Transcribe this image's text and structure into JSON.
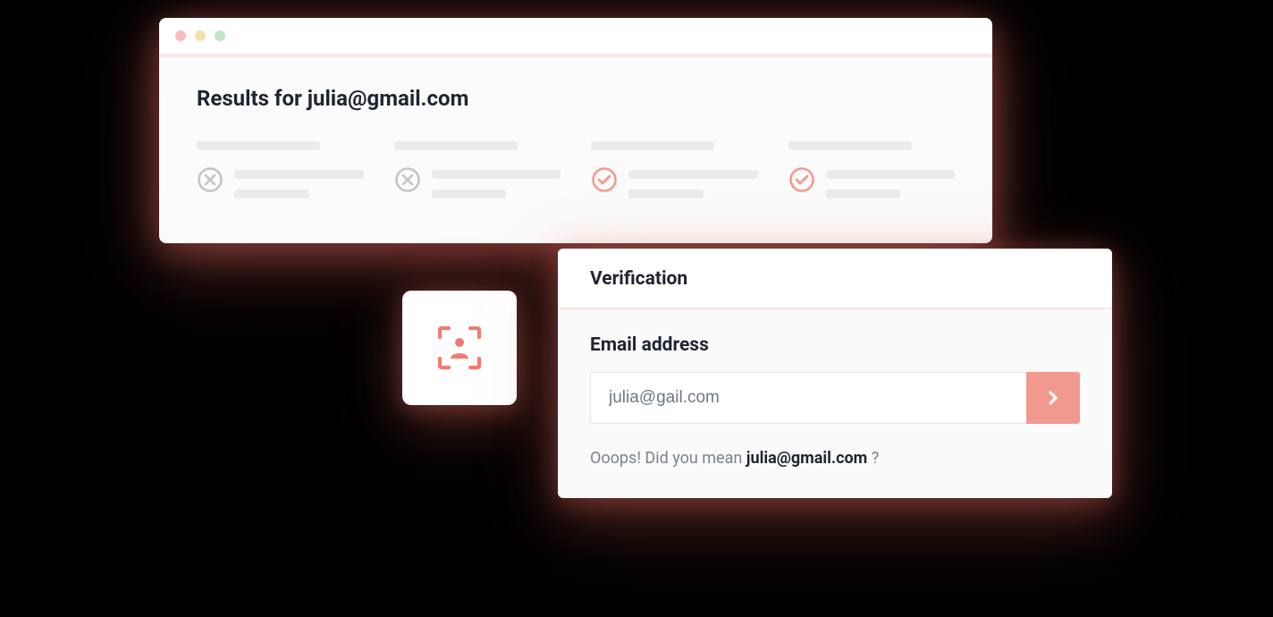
{
  "results": {
    "title": "Results for julia@gmail.com",
    "cards": [
      {
        "status": "fail"
      },
      {
        "status": "fail"
      },
      {
        "status": "pass"
      },
      {
        "status": "pass"
      }
    ]
  },
  "badge": {
    "icon": "scan-person-icon"
  },
  "verify": {
    "title": "Verification",
    "label": "Email address",
    "input_value": "julia@gail.com",
    "hint_prefix": "Ooops! Did you mean ",
    "hint_suggestion": "julia@gmail.com",
    "hint_suffix": " ?"
  }
}
